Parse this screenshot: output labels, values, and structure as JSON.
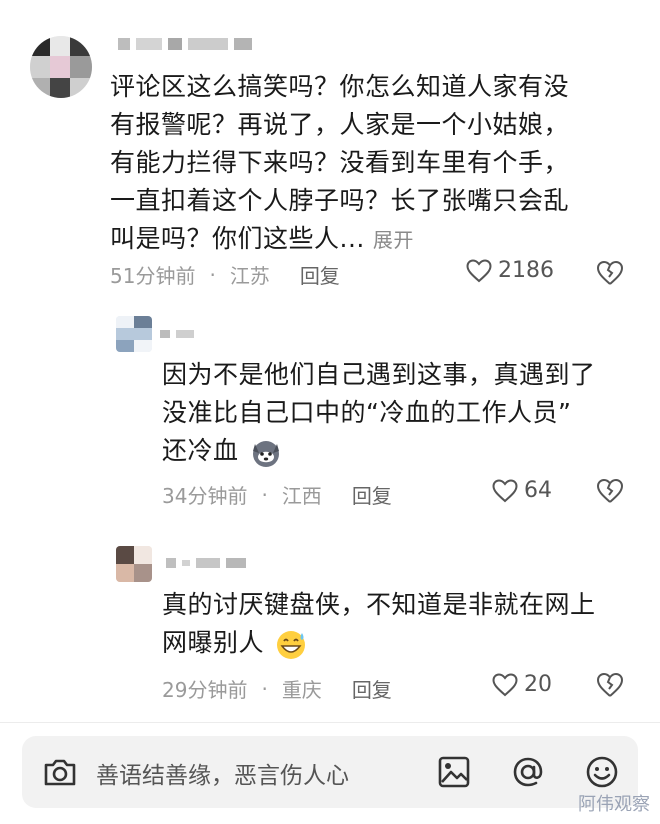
{
  "comments": [
    {
      "text": "评论区这么搞笑吗？你怎么知道人家有没有报警呢？再说了，人家是一个小姑娘，有能力拦得下来吗？没看到车里有个手，一直扣着这个人脖子吗？长了张嘴只会乱叫是吗？你们这些人...",
      "lines": [
        "评论区这么搞笑吗？你怎么知道人家有没",
        "有报警呢？再说了，人家是一个小姑娘，",
        "有能力拦得下来吗？没看到车里有个手，",
        "一直扣着这个人脖子吗？长了张嘴只会乱",
        "叫是吗？你们这些人..."
      ],
      "expand_label": "展开",
      "time": "51分钟前",
      "location": "江苏",
      "reply_label": "回复",
      "likes": "2186"
    },
    {
      "lines": [
        "因为不是他们自己遇到这事，真遇到了",
        "没准比自己口中的“冷血的工作人员”",
        "还冷血"
      ],
      "time": "34分钟前",
      "location": "江西",
      "reply_label": "回复",
      "likes": "64"
    },
    {
      "lines": [
        "真的讨厌键盘侠，不知道是非就在网上",
        "网曝别人"
      ],
      "time": "29分钟前",
      "location": "重庆",
      "reply_label": "回复",
      "likes": "20"
    }
  ],
  "input": {
    "placeholder": "善语结善缘，恶言伤人心"
  },
  "watermark": "阿伟观察",
  "icons": {
    "camera": "camera-icon",
    "image": "image-icon",
    "mention": "at-icon",
    "emoji": "emoji-icon",
    "like": "heart-icon",
    "dislike": "broken-heart-icon"
  }
}
